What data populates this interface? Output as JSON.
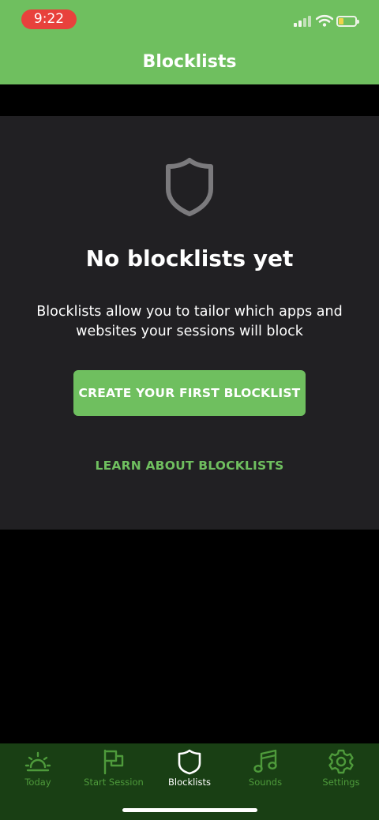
{
  "status_bar": {
    "time": "9:22",
    "time_bg_color": "#e8413c",
    "icons": [
      "cellular-signal-icon",
      "wifi-icon",
      "battery-low-icon"
    ]
  },
  "header": {
    "title": "Blocklists",
    "bg_color": "#6fbf5f"
  },
  "empty_state": {
    "icon": "shield-icon",
    "title": "No blocklists yet",
    "description": "Blocklists allow you to tailor which apps and websites your sessions will block",
    "primary_button": "CREATE YOUR FIRST BLOCKLIST",
    "secondary_link": "LEARN ABOUT BLOCKLISTS"
  },
  "tab_bar": {
    "bg_color": "#193f14",
    "active_color": "#ffffff",
    "inactive_color": "#4e9a3b",
    "tabs": [
      {
        "label": "Today",
        "icon": "sunrise-icon",
        "active": false
      },
      {
        "label": "Start Session",
        "icon": "flag-icon",
        "active": false
      },
      {
        "label": "Blocklists",
        "icon": "shield-icon",
        "active": true
      },
      {
        "label": "Sounds",
        "icon": "music-note-icon",
        "active": false
      },
      {
        "label": "Settings",
        "icon": "gear-icon",
        "active": false
      }
    ]
  }
}
